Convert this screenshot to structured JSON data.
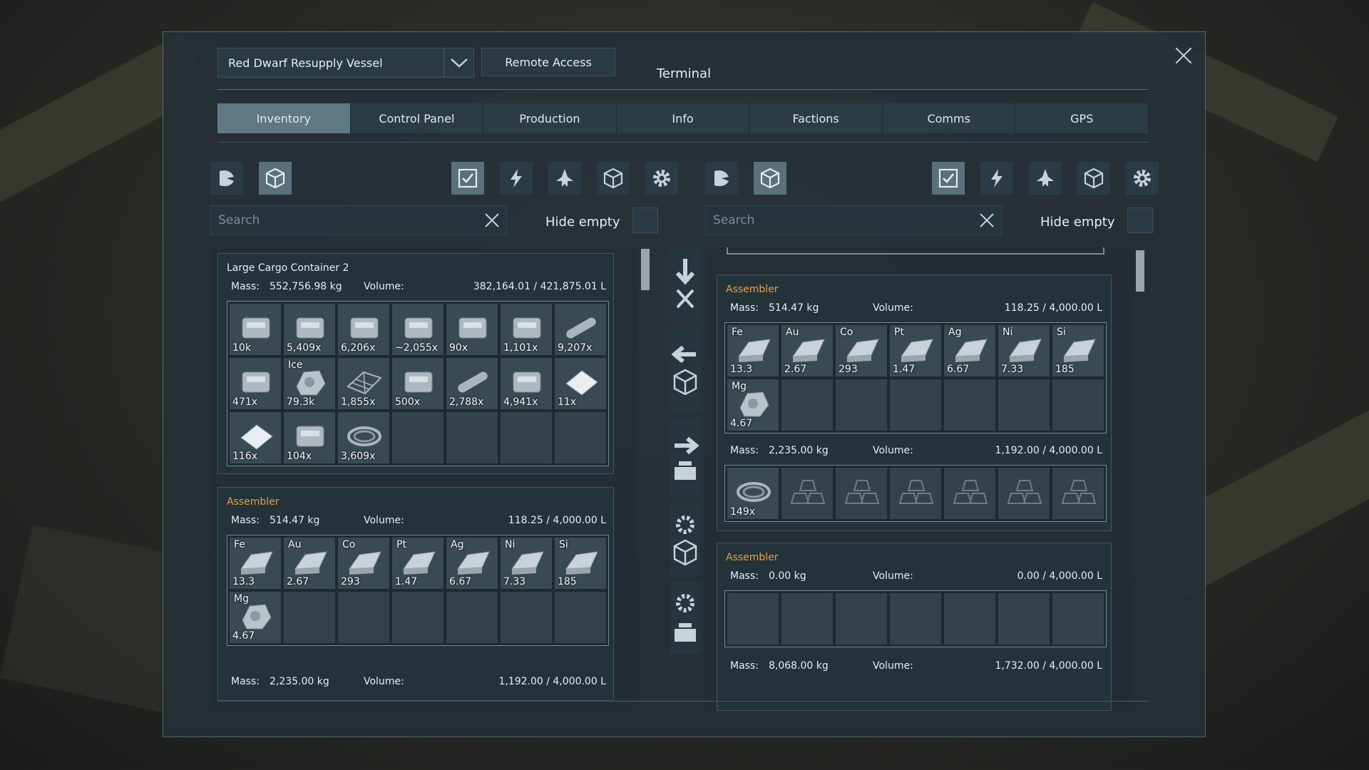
{
  "header": {
    "grid_name": "Red Dwarf Resupply Vessel",
    "remote_access": "Remote Access",
    "title": "Terminal"
  },
  "tabs": [
    {
      "label": "Inventory",
      "active": true
    },
    {
      "label": "Control Panel"
    },
    {
      "label": "Production"
    },
    {
      "label": "Info"
    },
    {
      "label": "Factions"
    },
    {
      "label": "Comms"
    },
    {
      "label": "GPS"
    }
  ],
  "left": {
    "search_placeholder": "Search",
    "hide_empty": "Hide empty",
    "containers": [
      {
        "name": "Large Cargo Container 2",
        "mass_label": "Mass:",
        "mass": "552,756.98 kg",
        "volume_label": "Volume:",
        "volume": "382,164.01 / 421,875.01 L",
        "items": [
          {
            "qty": "10k",
            "icon": "steel-plate-icon"
          },
          {
            "qty": "5,409x",
            "icon": "tank-component-icon"
          },
          {
            "qty": "6,206x",
            "icon": "construction-comp-icon"
          },
          {
            "qty": "~2,055x",
            "icon": "motor-icon"
          },
          {
            "qty": "90x",
            "icon": "computer-icon"
          },
          {
            "qty": "1,101x",
            "icon": "drill-component-icon"
          },
          {
            "qty": "9,207x",
            "icon": "small-tube-icon"
          },
          {
            "qty": "471x",
            "icon": "power-cell-icon"
          },
          {
            "sym": "Ice",
            "qty": "79.3k",
            "icon": "ice-ore-icon"
          },
          {
            "qty": "1,855x",
            "icon": "metal-grid-icon"
          },
          {
            "qty": "500x",
            "icon": "interior-plate-icon"
          },
          {
            "qty": "2,788x",
            "icon": "large-tube-icon"
          },
          {
            "qty": "4,941x",
            "icon": "reactor-comp-icon"
          },
          {
            "qty": "11x",
            "icon": "display-icon"
          },
          {
            "qty": "116x",
            "icon": "bulletproof-glass-icon"
          },
          {
            "qty": "104x",
            "icon": "girder-icon"
          },
          {
            "qty": "3,609x",
            "icon": "superconductor-icon"
          }
        ],
        "slot_count": 21
      },
      {
        "name": "Assembler",
        "orange": true,
        "mass_label": "Mass:",
        "mass": "514.47 kg",
        "volume_label": "Volume:",
        "volume": "118.25 / 4,000.00 L",
        "items": [
          {
            "sym": "Fe",
            "qty": "13.3",
            "icon": "iron-ingot-icon"
          },
          {
            "sym": "Au",
            "qty": "2.67",
            "icon": "gold-ingot-icon"
          },
          {
            "sym": "Co",
            "qty": "293",
            "icon": "cobalt-ingot-icon"
          },
          {
            "sym": "Pt",
            "qty": "1.47",
            "icon": "platinum-ingot-icon"
          },
          {
            "sym": "Ag",
            "qty": "6.67",
            "icon": "silver-ingot-icon"
          },
          {
            "sym": "Ni",
            "qty": "7.33",
            "icon": "nickel-ingot-icon"
          },
          {
            "sym": "Si",
            "qty": "185",
            "icon": "silicon-wafer-icon"
          },
          {
            "sym": "Mg",
            "qty": "4.67",
            "icon": "magnesium-powder-icon"
          }
        ],
        "slot_count": 14,
        "footer_mass_label": "Mass:",
        "footer_mass": "2,235.00 kg",
        "footer_volume_label": "Volume:",
        "footer_volume": "1,192.00 / 4,000.00 L"
      }
    ]
  },
  "right": {
    "search_placeholder": "Search",
    "hide_empty": "Hide empty",
    "containers": [
      {
        "name": "Assembler",
        "orange": true,
        "mass_label": "Mass:",
        "mass": "514.47 kg",
        "volume_label": "Volume:",
        "volume": "118.25 / 4,000.00 L",
        "items": [
          {
            "sym": "Fe",
            "qty": "13.3",
            "icon": "iron-ingot-icon"
          },
          {
            "sym": "Au",
            "qty": "2.67",
            "icon": "gold-ingot-icon"
          },
          {
            "sym": "Co",
            "qty": "293",
            "icon": "cobalt-ingot-icon"
          },
          {
            "sym": "Pt",
            "qty": "1.47",
            "icon": "platinum-ingot-icon"
          },
          {
            "sym": "Ag",
            "qty": "6.67",
            "icon": "silver-ingot-icon"
          },
          {
            "sym": "Ni",
            "qty": "7.33",
            "icon": "nickel-ingot-icon"
          },
          {
            "sym": "Si",
            "qty": "185",
            "icon": "silicon-wafer-icon"
          },
          {
            "sym": "Mg",
            "qty": "4.67",
            "icon": "magnesium-powder-icon"
          }
        ],
        "slot_count": 14,
        "sub_mass_label": "Mass:",
        "sub_mass": "2,235.00 kg",
        "sub_volume_label": "Volume:",
        "sub_volume": "1,192.00 / 4,000.00 L",
        "sub_items": [
          {
            "qty": "149x",
            "icon": "superconductor-icon"
          }
        ],
        "sub_slot_count": 7
      },
      {
        "name": "Assembler",
        "orange": true,
        "mass_label": "Mass:",
        "mass": "0.00 kg",
        "volume_label": "Volume:",
        "volume": "0.00 / 4,000.00 L",
        "items": [],
        "slot_count": 7,
        "footer_mass_label": "Mass:",
        "footer_mass": "8,068.00 kg",
        "footer_volume_label": "Volume:",
        "footer_volume": "1,732.00 / 4,000.00 L"
      }
    ]
  }
}
